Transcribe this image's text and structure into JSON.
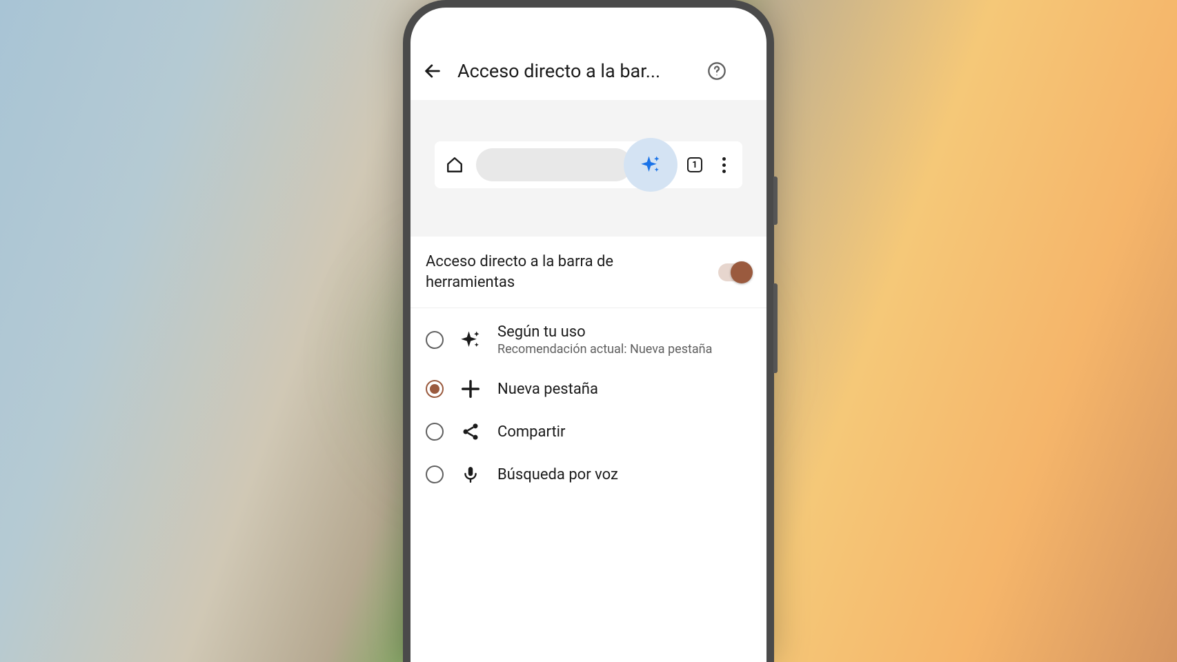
{
  "appbar": {
    "title": "Acceso directo a la bar..."
  },
  "preview": {
    "tabs_count": "1"
  },
  "toggle": {
    "label": "Acceso directo a la barra de herramientas",
    "enabled": true
  },
  "options": {
    "selected_index": 1,
    "items": [
      {
        "id": "based-on-usage",
        "label": "Según tu uso",
        "sub": "Recomendación actual: Nueva pestaña"
      },
      {
        "id": "new-tab",
        "label": "Nueva pestaña"
      },
      {
        "id": "share",
        "label": "Compartir"
      },
      {
        "id": "voice-search",
        "label": "Búsqueda por voz"
      }
    ]
  },
  "colors": {
    "accent": "#9a5a3e",
    "sparkle": "#1a73e8"
  }
}
